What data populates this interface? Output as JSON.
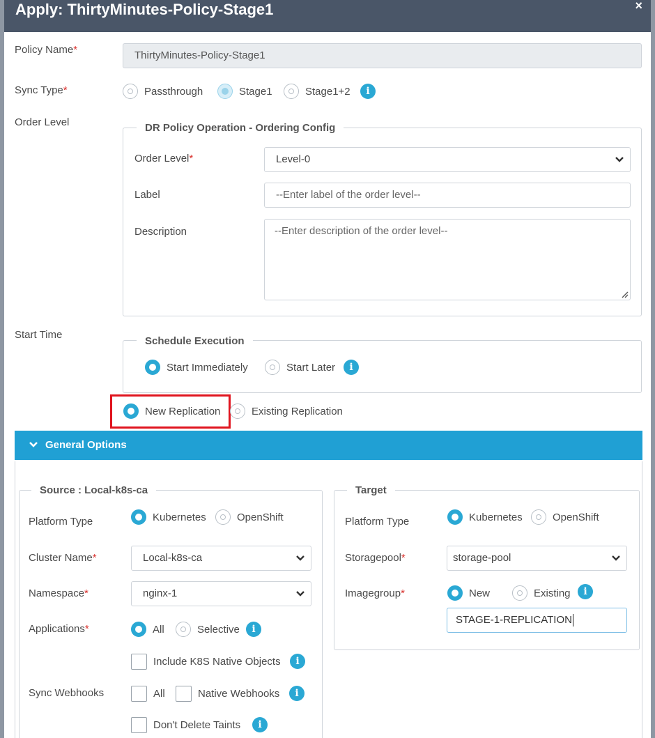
{
  "dialog": {
    "title": "Apply: ThirtyMinutes-Policy-Stage1",
    "close_glyph": "×"
  },
  "policy_name": {
    "label": "Policy Name",
    "value": "ThirtyMinutes-Policy-Stage1"
  },
  "sync_type": {
    "label": "Sync Type",
    "options": [
      "Passthrough",
      "Stage1",
      "Stage1+2"
    ],
    "selected": "Stage1"
  },
  "order_level_section": {
    "label": "Order Level",
    "legend": "DR Policy Operation - Ordering Config",
    "order_level": {
      "label": "Order Level",
      "value": "Level-0"
    },
    "label_field": {
      "label": "Label",
      "placeholder": "--Enter label of the order level--"
    },
    "description": {
      "label": "Description",
      "placeholder": "--Enter description of the order level--"
    }
  },
  "start_time": {
    "label": "Start Time",
    "legend": "Schedule Execution",
    "options": [
      "Start Immediately",
      "Start Later"
    ],
    "selected": "Start Immediately"
  },
  "replication": {
    "options": [
      "New Replication",
      "Existing Replication"
    ],
    "selected": "New Replication"
  },
  "general_options": {
    "title": "General Options",
    "source": {
      "legend": "Source : Local-k8s-ca",
      "platform_type": {
        "label": "Platform Type",
        "options": [
          "Kubernetes",
          "OpenShift"
        ],
        "selected": "Kubernetes"
      },
      "cluster_name": {
        "label": "Cluster Name",
        "value": "Local-k8s-ca"
      },
      "namespace": {
        "label": "Namespace",
        "value": "nginx-1"
      },
      "applications": {
        "label": "Applications",
        "options": [
          "All",
          "Selective"
        ],
        "selected": "All"
      },
      "include_native": "Include K8S Native Objects",
      "sync_webhooks": {
        "label": "Sync Webhooks",
        "all": "All",
        "native": "Native Webhooks"
      },
      "dont_delete_taints": "Don't Delete Taints"
    },
    "target": {
      "legend": "Target",
      "platform_type": {
        "label": "Platform Type",
        "options": [
          "Kubernetes",
          "OpenShift"
        ],
        "selected": "Kubernetes"
      },
      "storagepool": {
        "label": "Storagepool",
        "value": "storage-pool"
      },
      "imagegroup": {
        "label": "Imagegroup",
        "options": [
          "New",
          "Existing"
        ],
        "selected": "New",
        "value": "STAGE-1-REPLICATION"
      }
    }
  },
  "required_mark": "*",
  "info_glyph": "i",
  "colors": {
    "accent": "#20a0d4",
    "titlebar": "#4a5668",
    "required": "#d9322e",
    "highlight": "#e0141e"
  }
}
